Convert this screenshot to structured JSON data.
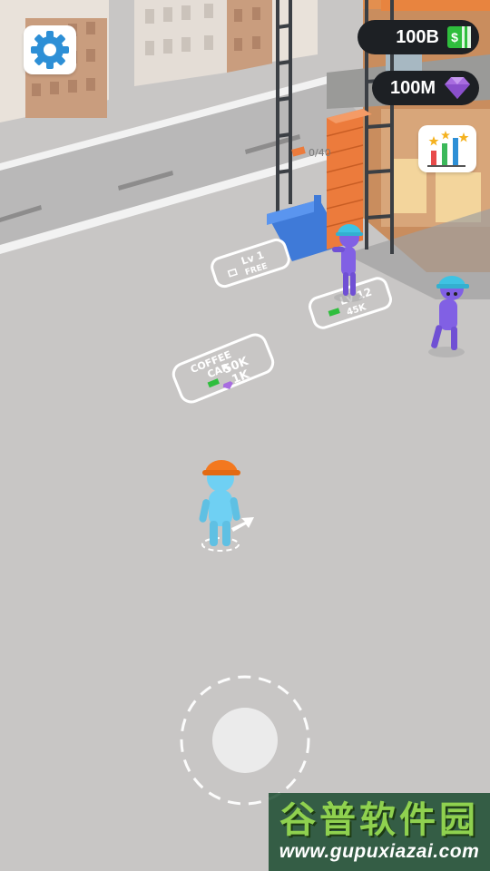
{
  "hud": {
    "cash_value": "100B",
    "cash_icon": "dollar-bill-icon",
    "gems_value": "100M",
    "gems_icon": "diamond-icon",
    "settings_icon": "gear-icon",
    "stats_icon": "bar-chart-stars-icon"
  },
  "world": {
    "lift_counter": "0/40",
    "pads": {
      "lv1": {
        "title": "Lv 1",
        "price": "FREE"
      },
      "lv12": {
        "title": "Lv 12",
        "price": "45K"
      },
      "coffee": {
        "line1": "COFFEE",
        "line2": "CAR",
        "cash_price": "50K",
        "gem_price": "1K"
      }
    }
  },
  "watermark": {
    "title": "谷普软件园",
    "url": "www.gupuxiazai.com"
  },
  "colors": {
    "ground": "#c8c6c5",
    "player": "#6fd0f3",
    "player_helmet": "#f3781f",
    "worker": "#8160e4",
    "worker_helmet": "#3ec3e3",
    "brick": "#ec7b3c",
    "hud_background": "#1d2024",
    "cash_green": "#2fbe3d",
    "gem_purple": "#a86ce0"
  }
}
